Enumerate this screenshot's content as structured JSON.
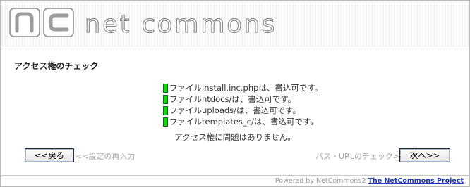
{
  "header": {
    "logo_text": "net commons",
    "logo_mark": "nc-logo"
  },
  "section": {
    "title": "アクセス権のチェック"
  },
  "checks": [
    {
      "status": "ok",
      "text": "ファイルinstall.inc.phpは、書込可です。"
    },
    {
      "status": "ok",
      "text": "ファイルhtdocs/は、書込可です。"
    },
    {
      "status": "ok",
      "text": "ファイルuploads/は、書込可です。"
    },
    {
      "status": "ok",
      "text": "ファイルtemplates_c/は、書込可です。"
    }
  ],
  "result_message": "アクセス権に問題はありません。",
  "nav": {
    "back_label": "<<戻る",
    "back_hint": "<<設定の再入力",
    "next_hint": "パス・URLのチェック>>",
    "next_label": "次へ>>"
  },
  "footer": {
    "powered_text": "Powered by NetCommons2",
    "project_link": "The NetCommons Project"
  },
  "colors": {
    "ok_indicator": "#19d019",
    "link": "#1c36b8",
    "muted_hint": "#a8a8a8"
  }
}
